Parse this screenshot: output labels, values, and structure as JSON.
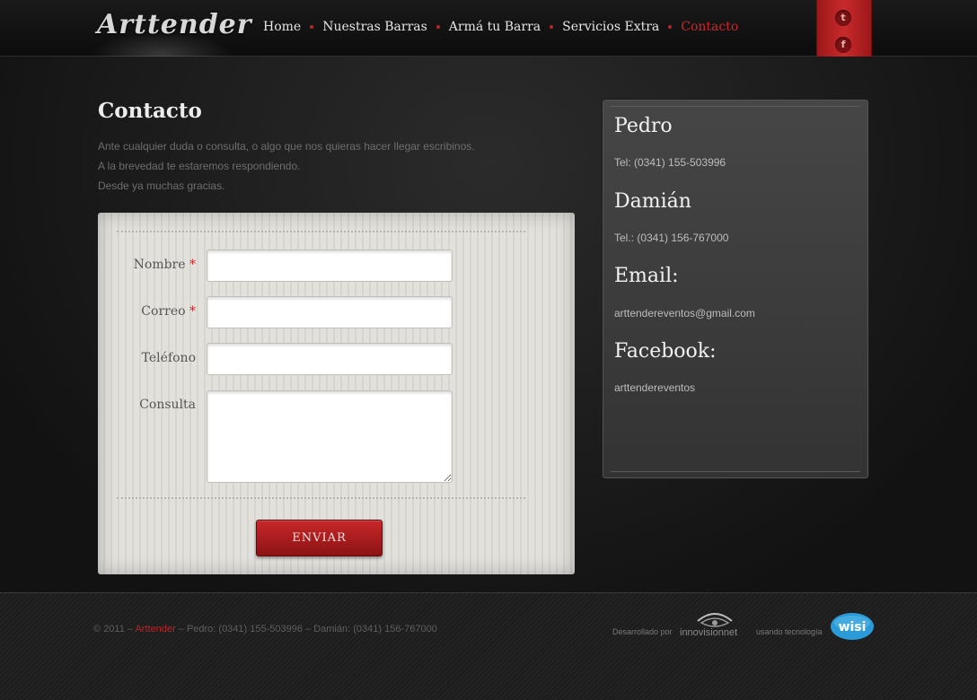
{
  "header": {
    "logo": "Arttender",
    "nav": [
      {
        "label": "Home",
        "active": false
      },
      {
        "label": "Nuestras Barras",
        "active": false
      },
      {
        "label": "Armá tu Barra",
        "active": false
      },
      {
        "label": "Servicios Extra",
        "active": false
      },
      {
        "label": "Contacto",
        "active": true
      }
    ],
    "social": {
      "twitter_glyph": "t",
      "facebook_glyph": "f"
    }
  },
  "page": {
    "title": "Contacto",
    "intro": [
      "Ante cualquier duda o consulta, o algo que nos quieras hacer llegar escribinos.",
      "A la brevedad te estaremos respondiendo.",
      "Desde ya muchas gracias."
    ]
  },
  "form": {
    "fields": [
      {
        "label": "Nombre",
        "required": true,
        "value": ""
      },
      {
        "label": "Correo",
        "required": true,
        "value": ""
      },
      {
        "label": "Teléfono",
        "required": false,
        "value": ""
      },
      {
        "label": "Consulta",
        "required": false,
        "value": ""
      }
    ],
    "required_mark": "*",
    "submit_label": "ENVIAR"
  },
  "contact_card": {
    "sections": [
      {
        "heading": "Pedro",
        "text": "Tel: (0341) 155-503996"
      },
      {
        "heading": "Damián",
        "text": "Tel.: (0341) 156-767000"
      },
      {
        "heading": "Email:",
        "text": "arttendereventos@gmail.com"
      },
      {
        "heading": "Facebook:",
        "text": "arttendereventos"
      }
    ]
  },
  "footer": {
    "copyright_prefix": "© 2011 –",
    "brand": "Arttender",
    "copyright_suffix": "– Pedro: (0341) 155-503996 – Damián: (0341) 156-767000",
    "developed_by": "Desarrollado por",
    "dev_logo_text": "innovisionnet",
    "using_tech": "usando tecnología",
    "tech_logo_text": "wisi"
  },
  "colors": {
    "accent": "#c8282a",
    "background": "#1b1b1b",
    "card": "#3c3c3c"
  }
}
